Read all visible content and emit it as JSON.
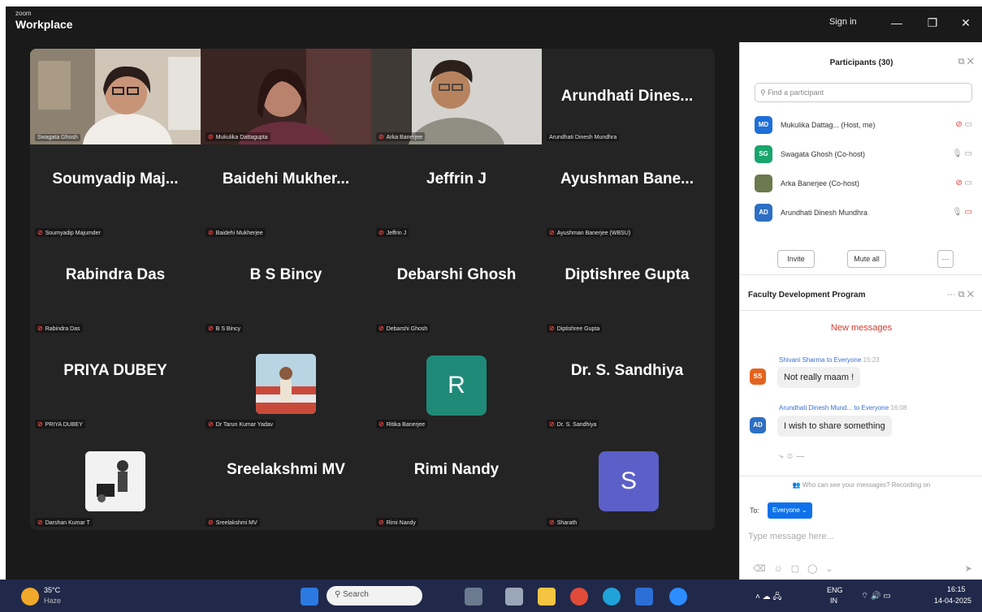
{
  "titlebar": {
    "brand_top": "zoom",
    "brand": "Workplace",
    "signin": "Sign in",
    "minimize": "—",
    "restore": "❐",
    "close": "✕"
  },
  "tiles": [
    {
      "big": "",
      "tag": "Swagata Ghosh"
    },
    {
      "big": "",
      "tag": "Mukulika Dattagupta"
    },
    {
      "big": "",
      "tag": "Arka Banerjee"
    },
    {
      "big": "Arundhati Dines...",
      "tag": "Arundhati Dinesh Mundhra"
    },
    {
      "big": "Soumyadip Maj...",
      "tag": "Soumyadip Majumder"
    },
    {
      "big": "Baidehi Mukher...",
      "tag": "Baidehi Mukherjee"
    },
    {
      "big": "Jeffrin J",
      "tag": "Jeffrin J"
    },
    {
      "big": "Ayushman Bane...",
      "tag": "Ayushman Banerjee (WBSU)"
    },
    {
      "big": "Rabindra Das",
      "tag": "Rabindra Das"
    },
    {
      "big": "B S Bincy",
      "tag": "B S Bincy"
    },
    {
      "big": "Debarshi Ghosh",
      "tag": "Debarshi Ghosh"
    },
    {
      "big": "Diptishree Gupta",
      "tag": "Diptishree Gupta"
    },
    {
      "big": "PRIYA DUBEY",
      "tag": "PRIYA DUBEY"
    },
    {
      "big": "",
      "tag": "Dr Tarun Kumar Yadav"
    },
    {
      "big": "R",
      "tag": "Ritika Banerjee"
    },
    {
      "big": "Dr. S. Sandhiya",
      "tag": "Dr. S. Sandhiya"
    },
    {
      "big": "",
      "tag": "Darshan Kumar T"
    },
    {
      "big": "Sreelakshmi MV",
      "tag": "Sreelakshmi MV"
    },
    {
      "big": "Rimi Nandy",
      "tag": "Rimi Nandy"
    },
    {
      "big": "S",
      "tag": "Sharath"
    }
  ],
  "colors": {
    "r_avatar": "#1f8a78",
    "s_avatar": "#5b5fc7",
    "md": "#1e6fd9",
    "sg": "#1aa56d",
    "ad": "#2d6fc3",
    "ss": "#e3641f",
    "accent": "#0e71eb"
  },
  "participants": {
    "title": "Participants (30)",
    "search_placeholder": "Find a participant",
    "list": [
      {
        "initials": "MD",
        "name": "Mukulika Dattag... (Host, me)"
      },
      {
        "initials": "SG",
        "name": "Swagata Ghosh (Co-host)"
      },
      {
        "initials": "",
        "name": "Arka Banerjee (Co-host)"
      },
      {
        "initials": "AD",
        "name": "Arundhati Dinesh Mundhra"
      }
    ],
    "invite": "Invite",
    "mute_all": "Mute all",
    "more": "···"
  },
  "chat": {
    "title": "Faculty Development Program",
    "new_messages": "New messages",
    "messages": [
      {
        "initials": "SS",
        "sender": "Shivani Sharma to Everyone",
        "time": "15:23",
        "text": "Not really maam !"
      },
      {
        "initials": "AD",
        "sender": "Arundhati Dinesh Mund... to Everyone",
        "time": "16:08",
        "text": "I wish to share something"
      }
    ],
    "notice": "Who can see your messages? Recording on",
    "to_label": "To:",
    "to_value": "Everyone ⌄",
    "placeholder": "Type message here..."
  },
  "taskbar": {
    "temp": "35°C",
    "weather": "Haze",
    "search": "Search",
    "lang1": "ENG",
    "lang2": "IN",
    "time": "16:15",
    "date": "14-04-2025"
  }
}
